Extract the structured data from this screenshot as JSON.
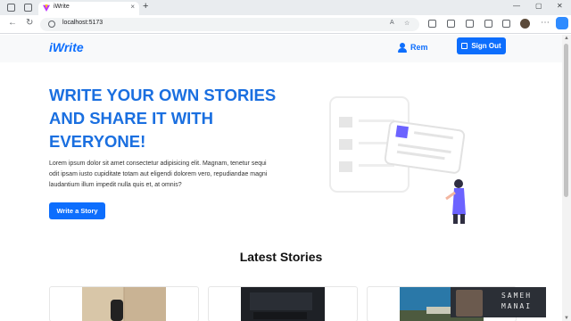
{
  "browser": {
    "tab_title": "iWrite",
    "tab_close": "×",
    "new_tab": "+",
    "address": "localhost:5173",
    "window_controls": [
      "—",
      "▢",
      "✕"
    ],
    "nav_icons": [
      "back-icon",
      "refresh-icon",
      "info-icon"
    ],
    "toolbar_icons": [
      "read-aloud-icon",
      "favorite-icon",
      "extensions-icon",
      "split-screen-icon",
      "favorites-bar-icon",
      "collections-icon",
      "security-icon",
      "profile-icon",
      "more-icon",
      "copilot-icon"
    ]
  },
  "navbar": {
    "brand": "iWrite",
    "user_name": "Rem",
    "signout_label": "Sign Out"
  },
  "hero": {
    "title_lines": [
      "WRITE YOUR OWN STORIES",
      "AND SHARE IT WITH",
      "EVERYONE!"
    ],
    "description": "Lorem ipsum dolor sit amet consectetur adipisicing elit. Magnam, tenetur sequi odit ipsam iusto cupiditate totam aut eligendi dolorem vero, repudiandae magni laudantium illum impedit nulla quis et, at omnis?",
    "cta_label": "Write a Story"
  },
  "latest": {
    "title": "Latest Stories"
  },
  "webcam_overlay": {
    "name_lines": [
      "SAMEH",
      "MANAI"
    ]
  },
  "colors": {
    "primary": "#0d6efd",
    "hero_title": "#1a6fe0",
    "accent_purple": "#6c63ff"
  }
}
